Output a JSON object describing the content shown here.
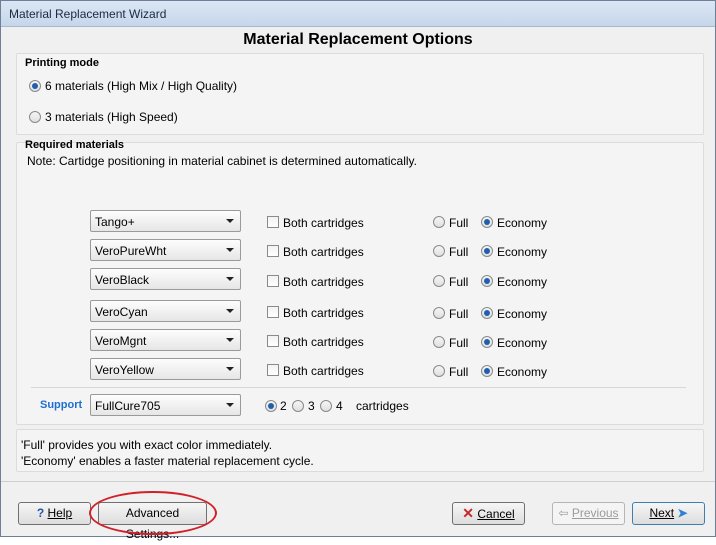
{
  "window": {
    "title": "Material Replacement Wizard"
  },
  "heading": "Material Replacement Options",
  "printing_mode": {
    "title": "Printing mode",
    "options": [
      {
        "label": "6 materials (High Mix / High Quality)",
        "selected": true
      },
      {
        "label": "3 materials (High Speed)",
        "selected": false
      }
    ]
  },
  "required_materials": {
    "title": "Required materials",
    "note": "Note: Cartidge positioning in material cabinet is determined automatically.",
    "both_label": "Both cartridges",
    "full_label": "Full",
    "economy_label": "Economy",
    "rows": [
      {
        "material": "Tango+",
        "both": false,
        "mode": "Economy"
      },
      {
        "material": "VeroPureWht",
        "both": false,
        "mode": "Economy"
      },
      {
        "material": "VeroBlack",
        "both": false,
        "mode": "Economy"
      },
      {
        "material": "VeroCyan",
        "both": false,
        "mode": "Economy"
      },
      {
        "material": "VeroMgnt",
        "both": false,
        "mode": "Economy"
      },
      {
        "material": "VeroYellow",
        "both": false,
        "mode": "Economy"
      }
    ],
    "support": {
      "label": "Support",
      "material": "FullCure705",
      "counts": [
        "2",
        "3",
        "4"
      ],
      "selected_count": "2",
      "cartridges_label": "cartridges"
    }
  },
  "info": {
    "line1": "'Full' provides you with exact color immediately.",
    "line2": "'Economy' enables a faster material replacement cycle."
  },
  "buttons": {
    "help": "Help",
    "advanced": "Advanced Settings...",
    "cancel": "Cancel",
    "previous": "Previous",
    "next": "Next"
  },
  "colors": {
    "support_label": "#1e6fd0",
    "cancel_icon": "#c62828",
    "next_arrow": "#2f7fd8"
  }
}
